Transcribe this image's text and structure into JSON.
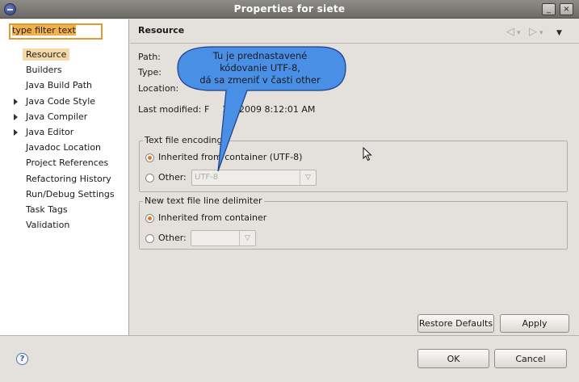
{
  "window": {
    "title": "Properties for siete",
    "buttons": {
      "minimize": "_",
      "maximize": "□",
      "close": "×"
    }
  },
  "filter": {
    "value": "type filter text"
  },
  "tree": [
    {
      "label": "Resource",
      "selected": true,
      "expandable": false
    },
    {
      "label": "Builders",
      "expandable": false
    },
    {
      "label": "Java Build Path",
      "expandable": false
    },
    {
      "label": "Java Code Style",
      "expandable": true
    },
    {
      "label": "Java Compiler",
      "expandable": true
    },
    {
      "label": "Java Editor",
      "expandable": true
    },
    {
      "label": "Javadoc Location",
      "expandable": false
    },
    {
      "label": "Project References",
      "expandable": false
    },
    {
      "label": "Refactoring History",
      "expandable": false
    },
    {
      "label": "Run/Debug Settings",
      "expandable": false
    },
    {
      "label": "Task Tags",
      "expandable": false
    },
    {
      "label": "Validation",
      "expandable": false
    }
  ],
  "page": {
    "title": "Resource",
    "path_label": "Path:",
    "type_label": "Type:",
    "location_label": "Location:",
    "last_modified_label": "Last modified:",
    "last_modified_value": "11, 2009 8:12:01 AM",
    "last_modified_prefix": "F"
  },
  "encoding": {
    "group_title": "Text file encoding",
    "inherited_label": "Inherited from container (UTF-8)",
    "other_label": "Other:",
    "other_value": "UTF-8"
  },
  "delimiter": {
    "group_title": "New text file line delimiter",
    "inherited_label": "Inherited from container",
    "other_label": "Other:",
    "other_value": ""
  },
  "buttons": {
    "restore_defaults": "Restore Defaults",
    "apply": "Apply",
    "ok": "OK",
    "cancel": "Cancel",
    "help": "?"
  },
  "icons": {
    "nav_back": "◁",
    "nav_forward": "▷",
    "nav_menu": "▼",
    "nav_drop": "▾",
    "combo_arrow": "▽",
    "tree_twisty": "triangle-right-icon"
  },
  "callout": {
    "line1": "Tu je prednastavené",
    "line2": "kódovanie UTF-8,",
    "line3": "dá sa zmeniť v časti other"
  },
  "colors": {
    "selection": "#f5d9a8",
    "focus": "#e39a2d",
    "callout_fill": "#4a8fe6",
    "radio_dot": "#e0782a"
  }
}
